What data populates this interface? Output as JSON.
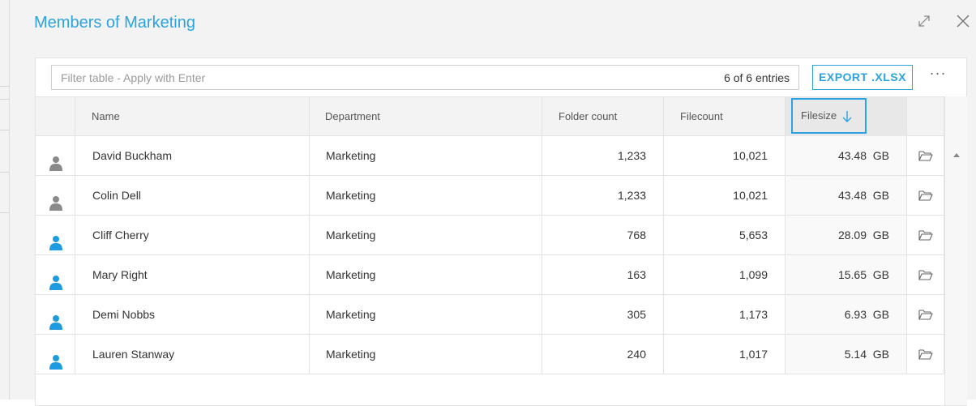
{
  "dialog": {
    "title": "Members of Marketing",
    "expand_icon": "expand-icon",
    "close_icon": "close-icon"
  },
  "toolbar": {
    "filter_placeholder": "Filter table - Apply with Enter",
    "filter_value": "",
    "entries": "6 of 6 entries",
    "export_label": "EXPORT .XLSX",
    "more_label": "···"
  },
  "table": {
    "columns": {
      "name": "Name",
      "department": "Department",
      "folder_count": "Folder count",
      "filecount": "Filecount",
      "filesize": "Filesize"
    },
    "sort": {
      "column": "filesize",
      "direction": "descending"
    },
    "rows": [
      {
        "icon": "user-gray-icon",
        "name": "David Buckham",
        "department": "Marketing",
        "folder_count": "1,233",
        "filecount": "10,021",
        "filesize": "43.48  GB"
      },
      {
        "icon": "user-gray-icon",
        "name": "Colin Dell",
        "department": "Marketing",
        "folder_count": "1,233",
        "filecount": "10,021",
        "filesize": "43.48  GB"
      },
      {
        "icon": "user-blue-icon",
        "name": "Cliff Cherry",
        "department": "Marketing",
        "folder_count": "768",
        "filecount": "5,653",
        "filesize": "28.09  GB"
      },
      {
        "icon": "user-blue-icon",
        "name": "Mary Right",
        "department": "Marketing",
        "folder_count": "163",
        "filecount": "1,099",
        "filesize": "15.65  GB"
      },
      {
        "icon": "user-blue-icon",
        "name": "Demi Nobbs",
        "department": "Marketing",
        "folder_count": "305",
        "filecount": "1,173",
        "filesize": "6.93  GB"
      },
      {
        "icon": "user-blue-icon",
        "name": "Lauren Stanway",
        "department": "Marketing",
        "folder_count": "240",
        "filecount": "1,017",
        "filesize": "5.14  GB"
      }
    ]
  },
  "colors": {
    "accent": "#2aa3e0",
    "user_active": "#1e9be0",
    "user_inactive": "#8a8a8a"
  }
}
